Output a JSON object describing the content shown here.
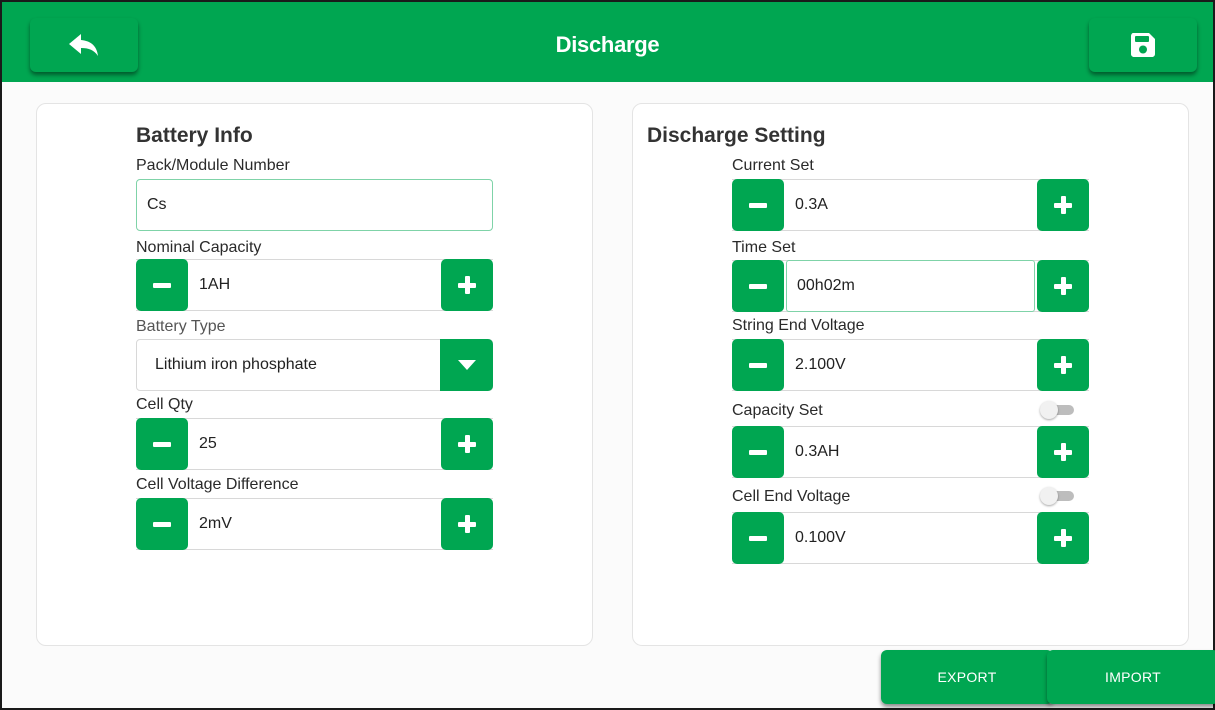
{
  "header": {
    "title": "Discharge",
    "background_color": "#00a651"
  },
  "battery_info": {
    "title": "Battery Info",
    "pack_module_number": {
      "label": "Pack/Module Number",
      "value": "Cs"
    },
    "nominal_capacity": {
      "label": "Nominal Capacity",
      "value": "1AH"
    },
    "battery_type": {
      "label": "Battery Type",
      "value": "Lithium iron phosphate"
    },
    "cell_qty": {
      "label": "Cell Qty",
      "value": "25"
    },
    "cell_voltage_difference": {
      "label": "Cell Voltage Difference",
      "value": "2mV"
    }
  },
  "discharge_setting": {
    "title": "Discharge Setting",
    "current_set": {
      "label": "Current Set",
      "value": "0.3A"
    },
    "time_set": {
      "label": "Time Set",
      "value": "00h02m"
    },
    "string_end_voltage": {
      "label": "String End Voltage",
      "value": "2.100V"
    },
    "capacity_set": {
      "label": "Capacity Set",
      "value": "0.3AH",
      "enabled": false
    },
    "cell_end_voltage": {
      "label": "Cell End Voltage",
      "value": "0.100V",
      "enabled": false
    }
  },
  "footer": {
    "export_label": "EXPORT",
    "import_label": "IMPORT"
  },
  "colors": {
    "accent": "#00a651",
    "focus_border": "#7fd3a8"
  },
  "icons": {
    "back": "back-arrow-icon",
    "save": "floppy-disk-icon",
    "minus": "minus-icon",
    "plus": "plus-icon",
    "dropdown": "triangle-down-icon"
  }
}
